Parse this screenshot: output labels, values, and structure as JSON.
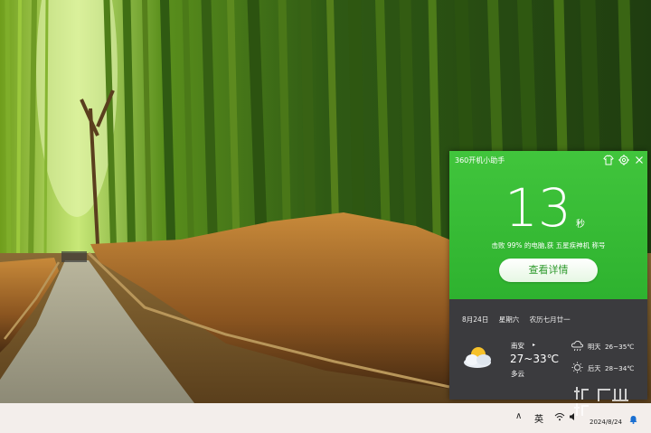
{
  "panel": {
    "title": "360开机小助手",
    "boot_time": "13",
    "boot_unit": "秒",
    "beat_text": "击败 99% 的电脑,获 五星疾神机 称号",
    "details_button": "查看详情"
  },
  "weather": {
    "date": "8月24日",
    "weekday": "星期六",
    "lunar": "农历七月廿一",
    "city": "南安",
    "city_arrow": "▸",
    "temp_range": "27~33℃",
    "condition": "多云",
    "forecast": [
      {
        "day": "明天",
        "range": "26~35℃",
        "icon": "cloud-rain-icon"
      },
      {
        "day": "后天",
        "range": "28~34℃",
        "icon": "sun-icon"
      }
    ],
    "main_icon": "partly-cloudy-icon"
  },
  "taskbar": {
    "chevron": "∧",
    "ime": "英",
    "date": "2024/8/24"
  },
  "colors": {
    "panel_green": "#35b934",
    "panel_dark": "#3b3b3e",
    "taskbar": "#f3eeeb"
  }
}
